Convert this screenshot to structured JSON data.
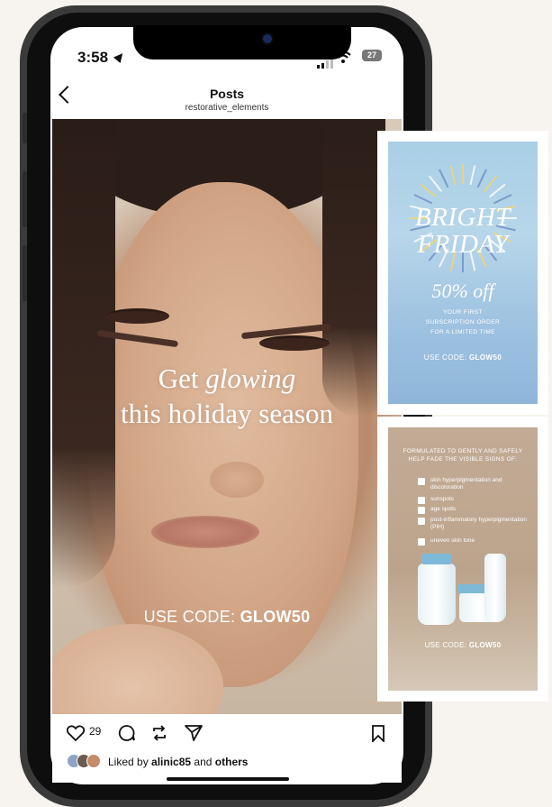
{
  "status_bar": {
    "time": "3:58",
    "battery": "27"
  },
  "nav": {
    "title": "Posts",
    "subtitle": "restorative_elements"
  },
  "post": {
    "headline_part1": "Get",
    "headline_italic": "glowing",
    "headline_line2": "this holiday season",
    "code_label": "USE CODE:",
    "code": "GLOW50",
    "like_count": "29",
    "liked_by_prefix": "Liked by",
    "liked_by_user": "alinic85",
    "liked_by_and": "and",
    "liked_by_others": "others"
  },
  "ad_card_1": {
    "title_line1": "BRIGHT",
    "title_line2": "FRIDAY",
    "discount": "50% off",
    "line1": "YOUR FIRST",
    "line2": "SUBSCRIPTION ORDER",
    "line3": "FOR A LIMITED TIME",
    "code_label": "USE CODE:",
    "code": "GLOW50"
  },
  "ad_card_2": {
    "heading_line1": "FORMULATED TO GENTLY AND SAFELY",
    "heading_line2": "HELP FADE THE VISIBLE SIGNS OF:",
    "items": [
      "skin hyperpigmentation and discoloration",
      "sunspots",
      "age spots",
      "post-inflammatory hyperpigmentation (PIH)",
      "uneven skin tone"
    ],
    "code_label": "USE CODE:",
    "code": "GLOW50"
  },
  "colors": {
    "page_bg": "#f7f3ee",
    "card1_bg": "#a9cfe6",
    "card2_bg": "#c2ab95",
    "phone_frame": "#3a3a3a"
  },
  "icons": [
    "location-arrow-icon",
    "signal-icon",
    "wifi-icon",
    "battery-icon",
    "back-chevron-icon",
    "heart-icon",
    "comment-icon",
    "repost-icon",
    "share-icon",
    "bookmark-icon",
    "checkbox-icon"
  ]
}
